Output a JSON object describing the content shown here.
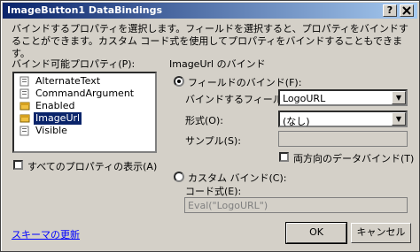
{
  "window": {
    "title": "ImageButton1 DataBindings",
    "help": "?",
    "close": "X"
  },
  "description": "バインドするプロパティを選択します。フィールドを選択すると、プロパティをバインドすることができます。カスタム コード式を使用してプロパティをバインドすることもできます。",
  "properties": {
    "label": "バインド可能プロパティ(P):",
    "items": [
      {
        "label": "AlternateText",
        "icon": "property-icon"
      },
      {
        "label": "CommandArgument",
        "icon": "property-icon"
      },
      {
        "label": "Enabled",
        "icon": "bound-property-icon"
      },
      {
        "label": "ImageUrl",
        "icon": "bound-property-icon"
      },
      {
        "label": "Visible",
        "icon": "property-icon"
      }
    ],
    "selected": "ImageUrl",
    "show_all_label": "すべてのプロパティの表示(A)",
    "show_all_checked": false
  },
  "binding": {
    "group_label": "ImageUrl のバインド",
    "field_binding_label": "フィールドのバインド(F):",
    "field_binding_selected": true,
    "bind_field_label": "バインドするフィールド",
    "bind_field_value": "LogoURL",
    "format_label": "形式(O):",
    "format_value": "(なし)",
    "sample_label": "サンプル(S):",
    "sample_value": "",
    "two_way_label": "両方向のデータバインド(T)",
    "two_way_checked": false,
    "custom_binding_label": "カスタム バインド(C):",
    "custom_binding_selected": false,
    "code_expr_label": "コード式(E):",
    "code_expr_value": "Eval(\"LogoURL\")"
  },
  "footer": {
    "refresh_schema": "スキーマの更新",
    "ok": "OK",
    "cancel": "キャンセル"
  }
}
